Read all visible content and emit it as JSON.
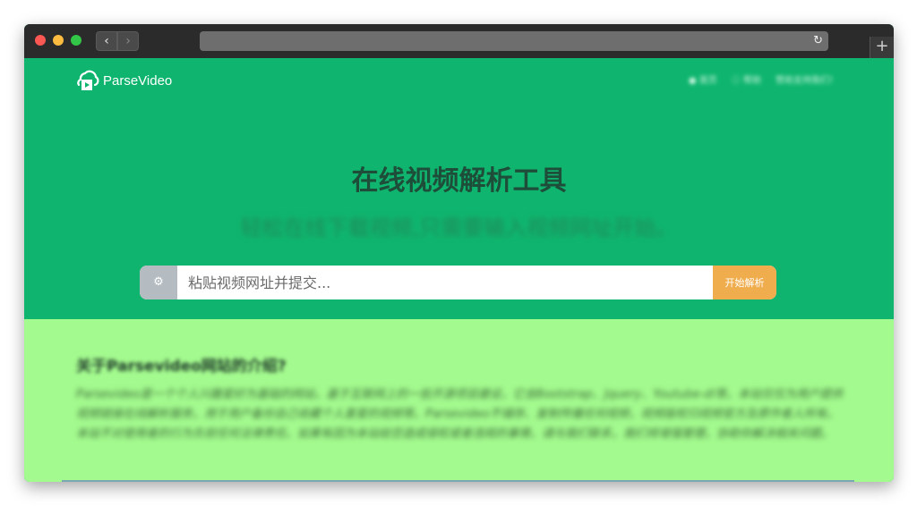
{
  "browser": {
    "back_glyph": "‹",
    "forward_glyph": "›",
    "reload_glyph": "↻",
    "newtab_glyph": "+"
  },
  "brand": {
    "name": "ParseVideo"
  },
  "topnav": {
    "items": [
      "● 首页",
      "ⓘ 帮助",
      "赞助支持我们！"
    ]
  },
  "hero": {
    "title": "在线视频解析工具",
    "subtitle": "轻松在线下载视频,只需要输入视频网址开始。"
  },
  "search": {
    "addon_glyph": "⚙",
    "placeholder": "粘贴视频网址并提交...",
    "value": "",
    "button_label": "开始解析"
  },
  "about": {
    "title": "关于Parsevideo网站的介绍?",
    "text": "Parsevideo是一个个人兴趣爱好为基础的网站，基于互联网上的一些开源项目建设，它含Bootstrap、Jquery、Youtube-dl等。本站仅仅为用户提供视频链接在线解析服务，用于用户备份自己收藏个人喜爱的视频等。Parsevideo不储存、复制传播任何视频，视频版权归视频官方及原作者人所有。本站不对使用者的行为负担任何法律责任。如果有因为本站给您造成侵权或者违规的事情，请与我们联系，我们将增强管理，协助你解决相关问题。"
  },
  "colors": {
    "hero_bg": "#0fb56e",
    "about_bg": "#a3fa8e",
    "button_bg": "#f0ad4e",
    "title_color": "#1e4d3a"
  }
}
